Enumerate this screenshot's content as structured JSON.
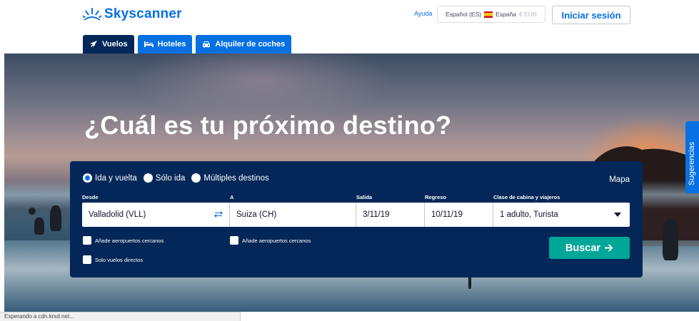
{
  "header": {
    "brand": "Skyscanner",
    "help": "Ayuda",
    "language": "Español (ES)",
    "country": "España",
    "currency": "€ EUR",
    "login": "Iniciar sesión"
  },
  "tabs": [
    {
      "label": "Vuelos",
      "icon": "plane-icon",
      "active": true
    },
    {
      "label": "Hoteles",
      "icon": "bed-icon",
      "active": false
    },
    {
      "label": "Alquiler de coches",
      "icon": "car-icon",
      "active": false
    }
  ],
  "hero": {
    "title": "¿Cuál es tu próximo destino?"
  },
  "search": {
    "trip_types": [
      {
        "label": "Ida y vuelta",
        "checked": true
      },
      {
        "label": "Sólo ida",
        "checked": false
      },
      {
        "label": "Múltiples destinos",
        "checked": false
      }
    ],
    "map": "Mapa",
    "labels": {
      "from": "Desde",
      "to": "A",
      "depart": "Salida",
      "return": "Regreso",
      "cabin": "Clase de cabina y viajeros"
    },
    "values": {
      "from": "Valladolid (VLL)",
      "to": "Suiza (CH)",
      "depart": "3/11/19",
      "return": "10/11/19",
      "cabin": "1 adulto, Turista"
    },
    "nearby_from": "Añade aeropuertos cercanos",
    "nearby_to": "Añade aeropuertos cercanos",
    "direct_only": "Solo vuelos directos",
    "submit": "Buscar"
  },
  "suggestions_tab": "Sugerencias",
  "status_bar": "Esperando a cdn.krxd.net...",
  "colors": {
    "brand_blue": "#0770e3",
    "panel_navy": "#042759",
    "search_green": "#00a698"
  }
}
